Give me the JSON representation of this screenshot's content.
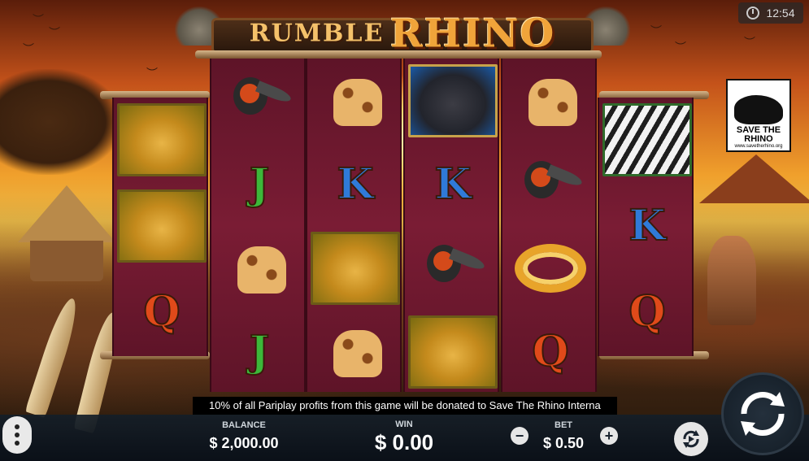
{
  "game": {
    "title_top": "RUMBLE",
    "title_main": "RHINO"
  },
  "clock": {
    "time": "12:54"
  },
  "sponsor": {
    "line1": "SAVE THE",
    "line2": "RHINO",
    "url": "www.savetherhino.org"
  },
  "reels": [
    {
      "id": "reel-1",
      "symbols": [
        "cheetah",
        "cheetah",
        "Q"
      ]
    },
    {
      "id": "reel-2",
      "symbols": [
        "hornbill",
        "J",
        "giraffe",
        "J"
      ]
    },
    {
      "id": "reel-3",
      "symbols": [
        "giraffe",
        "K",
        "cheetah",
        "giraffe"
      ]
    },
    {
      "id": "reel-4",
      "symbols": [
        "gorilla",
        "K",
        "hornbill",
        "cheetah"
      ]
    },
    {
      "id": "reel-5",
      "symbols": [
        "giraffe",
        "hornbill",
        "snake",
        "Q"
      ]
    },
    {
      "id": "reel-6",
      "symbols": [
        "zebra",
        "K",
        "Q"
      ]
    }
  ],
  "ticker": {
    "text": "10% of all Pariplay profits from this game will be donated to Save The Rhino Interna"
  },
  "bottom": {
    "balance_label": "BALANCE",
    "balance_value": "$ 2,000.00",
    "win_label": "WIN",
    "win_value": "$ 0.00",
    "bet_label": "BET",
    "bet_value": "$ 0.50",
    "bet_minus": "−",
    "bet_plus": "+"
  },
  "colors": {
    "reel_bg": "#7a1c34",
    "j_color": "#3cb83a",
    "k_color": "#2f7ad8",
    "q_color": "#e04a1a",
    "bar_bg": "#141e28"
  }
}
